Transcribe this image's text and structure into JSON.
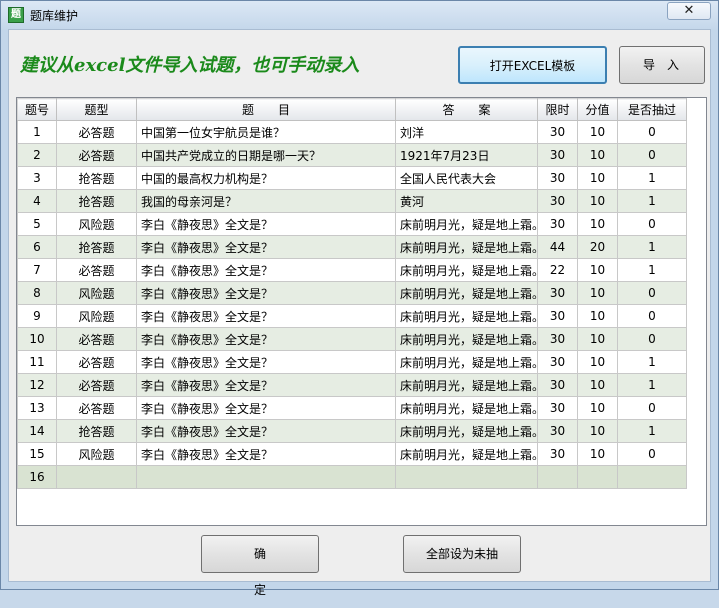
{
  "window": {
    "title": "题库维护",
    "close_glyph": "✕",
    "app_icon_glyph": "题"
  },
  "heading": "建议从excel文件导入试题，也可手动录入",
  "buttons": {
    "open_template": "打开EXCEL模板",
    "import": "导入",
    "ok": "确定",
    "reset_all": "全部设为未抽"
  },
  "colors": {
    "heading_green": "#1b8a1b",
    "alt_row": "#e6ede3",
    "grid_border": "#c8c8c8"
  },
  "grid": {
    "columns": [
      "题号",
      "题型",
      "题　　目",
      "答　　案",
      "限时",
      "分值",
      "是否抽过"
    ],
    "rows": [
      [
        "1",
        "必答题",
        "中国第一位女宇航员是谁？",
        "刘洋",
        "30",
        "10",
        "0"
      ],
      [
        "2",
        "必答题",
        "中国共产党成立的日期是哪一天？",
        "1921年7月23日",
        "30",
        "10",
        "0"
      ],
      [
        "3",
        "抢答题",
        "中国的最高权力机构是？",
        "全国人民代表大会",
        "30",
        "10",
        "1"
      ],
      [
        "4",
        "抢答题",
        "我国的母亲河是？",
        "黄河",
        "30",
        "10",
        "1"
      ],
      [
        "5",
        "风险题",
        "李白《静夜思》全文是？",
        "床前明月光，疑是地上霜。",
        "30",
        "10",
        "0"
      ],
      [
        "6",
        "抢答题",
        "李白《静夜思》全文是？",
        "床前明月光，疑是地上霜。",
        "44",
        "20",
        "1"
      ],
      [
        "7",
        "必答题",
        "李白《静夜思》全文是？",
        "床前明月光，疑是地上霜。",
        "22",
        "10",
        "1"
      ],
      [
        "8",
        "风险题",
        "李白《静夜思》全文是？",
        "床前明月光，疑是地上霜。",
        "30",
        "10",
        "0"
      ],
      [
        "9",
        "风险题",
        "李白《静夜思》全文是？",
        "床前明月光，疑是地上霜。",
        "30",
        "10",
        "0"
      ],
      [
        "10",
        "必答题",
        "李白《静夜思》全文是？",
        "床前明月光，疑是地上霜。",
        "30",
        "10",
        "0"
      ],
      [
        "11",
        "必答题",
        "李白《静夜思》全文是？",
        "床前明月光，疑是地上霜。",
        "30",
        "10",
        "1"
      ],
      [
        "12",
        "必答题",
        "李白《静夜思》全文是？",
        "床前明月光，疑是地上霜。",
        "30",
        "10",
        "1"
      ],
      [
        "13",
        "必答题",
        "李白《静夜思》全文是？",
        "床前明月光，疑是地上霜。",
        "30",
        "10",
        "0"
      ],
      [
        "14",
        "抢答题",
        "李白《静夜思》全文是？",
        "床前明月光，疑是地上霜。",
        "30",
        "10",
        "1"
      ],
      [
        "15",
        "风险题",
        "李白《静夜思》全文是？",
        "床前明月光，疑是地上霜。",
        "30",
        "10",
        "0"
      ]
    ],
    "new_row_number": "16"
  }
}
